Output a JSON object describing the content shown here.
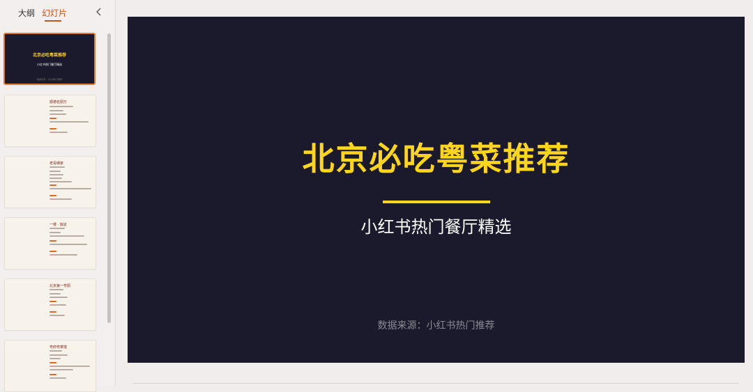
{
  "sidebar": {
    "tabs": {
      "outline": "大纲",
      "slides": "幻灯片"
    },
    "thumbnails": [
      {
        "selected": true,
        "title": "北京必吃粤菜推荐",
        "subtitle": "小红书热门餐厅精选",
        "source": "数据来源：小红书热门推荐"
      },
      {
        "heading": "顺德名厨万"
      },
      {
        "heading": "老青磚家"
      },
      {
        "heading": "一楼 · 饭店"
      },
      {
        "heading": "北京第一粤厨"
      },
      {
        "heading": "粤府粤菜馆"
      }
    ]
  },
  "slide": {
    "title": "北京必吃粤菜推荐",
    "subtitle": "小红书热门餐厅精选",
    "source": "数据来源：小红书热门推荐"
  },
  "colors": {
    "accent": "#c4561b",
    "slide_bg": "#1b1a2c",
    "title_yellow": "#ffd51e"
  },
  "icons": {
    "collapse": "chevron-left-icon"
  }
}
